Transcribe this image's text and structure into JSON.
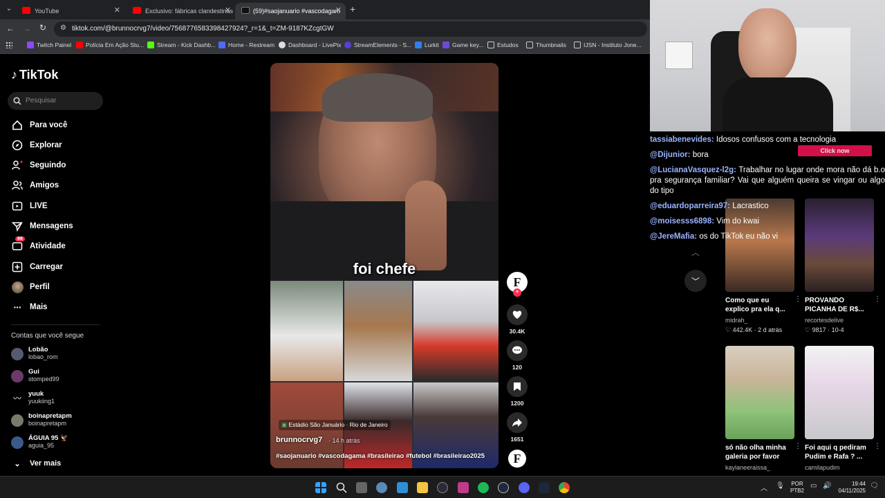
{
  "browser": {
    "tabs": [
      {
        "label": "YouTube",
        "color": "#ff0000"
      },
      {
        "label": "Exclusivo: fábricas clandestinas",
        "color": "#ff0000"
      },
      {
        "label": "(59)#saojanuario #vascodagam",
        "color": "#111111"
      }
    ],
    "url": "tiktok.com/@brunnocrvg7/video/7568776583398427924?_r=1&_t=ZM-9187KZcgtGW",
    "bookmarks": [
      {
        "label": "Twitch Painel",
        "color": "#9146ff"
      },
      {
        "label": "Polícia Em Ação Stu...",
        "color": "#ff0000"
      },
      {
        "label": "Stream - Kick Dashb...",
        "color": "#53fc18"
      },
      {
        "label": "Home - Restream",
        "color": "#4f6cf7"
      },
      {
        "label": "Dashboard - LivePix",
        "color": "#dddddd"
      },
      {
        "label": "StreamElements - S...",
        "color": "#5a3fd6"
      },
      {
        "label": "Lurkit",
        "color": "#2f80ed"
      },
      {
        "label": "Game key...",
        "color": "#6c4ad9"
      },
      {
        "label": "Estudos",
        "color": "#aaaaaa"
      },
      {
        "label": "Thumbnails",
        "color": "#aaaaaa"
      },
      {
        "label": "IJSN - Instituto Jone...",
        "color": "#aaaaaa"
      }
    ]
  },
  "tiktok": {
    "logo": "TikTok",
    "search_placeholder": "Pesquisar",
    "nav": [
      {
        "label": "Para você",
        "icon": "home-icon"
      },
      {
        "label": "Explorar",
        "icon": "compass-icon"
      },
      {
        "label": "Seguindo",
        "icon": "following-icon"
      },
      {
        "label": "Amigos",
        "icon": "friends-icon"
      },
      {
        "label": "LIVE",
        "icon": "live-icon"
      },
      {
        "label": "Mensagens",
        "icon": "messages-icon"
      },
      {
        "label": "Atividade",
        "icon": "activity-icon",
        "badge": "99"
      },
      {
        "label": "Carregar",
        "icon": "upload-icon"
      },
      {
        "label": "Perfil",
        "icon": "profile-avatar"
      },
      {
        "label": "Mais",
        "icon": "more-icon"
      }
    ],
    "following_title": "Contas que você segue",
    "following": [
      {
        "name": "Lobão",
        "handle": "lobao_rom",
        "color": "#555a70"
      },
      {
        "name": "Gui",
        "handle": "stomped99",
        "color": "#6b3a6b"
      },
      {
        "name": "yuuk",
        "handle": "yuukiing1",
        "color": "#ffffff"
      },
      {
        "name": "boinapretapm",
        "handle": "boinapretapm",
        "color": "#7a7a6a"
      },
      {
        "name": "ÁGUIA 95 🦅",
        "handle": "aguia_95",
        "color": "#3b5a8a"
      }
    ],
    "see_more": "Ver mais"
  },
  "video": {
    "caption": "foi chefe",
    "location": "Estádio São Januário · Rio de Janeiro",
    "author": "brunnocrvg7",
    "time": "· 14 h atrás",
    "hashtags": "#saojanuario #vascodagama #brasileirao #futebol #brasileirao2025",
    "likes": "30.4K",
    "comments": "120",
    "saves": "1200",
    "shares": "1651"
  },
  "chat": [
    {
      "user": "tassiabenevides:",
      "text": "Idosos confusos com a tecnologia"
    },
    {
      "user": "@Dijunior:",
      "text": "bora"
    },
    {
      "user": "@LucianaVasquez-l2g:",
      "text": "Trabalhar no lugar onde mora não dá b.o pra segurança familiar? Vai que alguém queira se vingar ou algo do tipo"
    },
    {
      "user": "@eduardoparreira97:",
      "text": "Lacrastico"
    },
    {
      "user": "@moisesss6898:",
      "text": "Vim do kwai"
    },
    {
      "user": "@JereMafia:",
      "text": "os do TikTok eu não vi"
    }
  ],
  "ad_button": "Click now",
  "recommended": [
    {
      "title": "Como que eu explico pra ela q...",
      "channel": "midrah_",
      "stats": "♡ 442.4K · 2 d atrás",
      "c1": "#b9784d",
      "c2": "#3a2a22"
    },
    {
      "title": "PROVANDO PICANHA DE R$...",
      "channel": "recortesdelive",
      "stats": "♡ 9817 · 10-4",
      "c1": "#5a3a7a",
      "c2": "#2a2030"
    },
    {
      "title": "só não olha minha galeria por favor",
      "channel": "kaylaneeraissa_",
      "stats": "",
      "c1": "#d8cfbf",
      "c2": "#8fc27a"
    },
    {
      "title": "Foi aqui q pediram Pudim e Rafa ? ...",
      "channel": "camilapudim",
      "stats": "",
      "c1": "#f2f2f2",
      "c2": "#c8c8cc"
    }
  ],
  "taskbar": {
    "lang_top": "POR",
    "lang_bottom": "PTB2",
    "time": "19:44",
    "date": "04/11/2025"
  }
}
